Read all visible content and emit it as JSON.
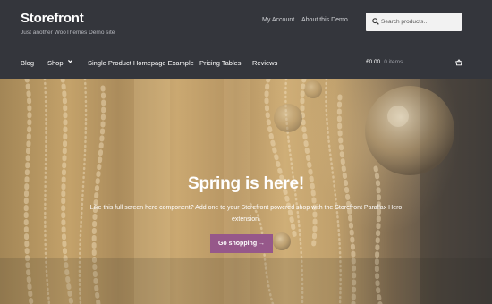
{
  "site": {
    "title": "Storefront",
    "tagline": "Just another WooThemes Demo site"
  },
  "secondary_nav": [
    "My Account",
    "About this Demo"
  ],
  "search": {
    "placeholder": "Search products…"
  },
  "primary_nav": [
    "Blog",
    "Shop",
    "Single Product Homepage Example",
    "Pricing Tables",
    "Reviews"
  ],
  "cart": {
    "total": "£0.00",
    "count": "0 items"
  },
  "hero": {
    "title": "Spring is here!",
    "text_line1": "Like this full screen hero component? Add one to your Storefront powered shop with the Storefront Parallax Hero",
    "text_line2": "extension.",
    "button": "Go shopping →"
  },
  "colors": {
    "header_bg": "#34363c",
    "button_bg": "#96588a",
    "text_light": "#ffffff"
  },
  "icons": [
    "search-icon",
    "chevron-down-icon",
    "basket-icon"
  ]
}
